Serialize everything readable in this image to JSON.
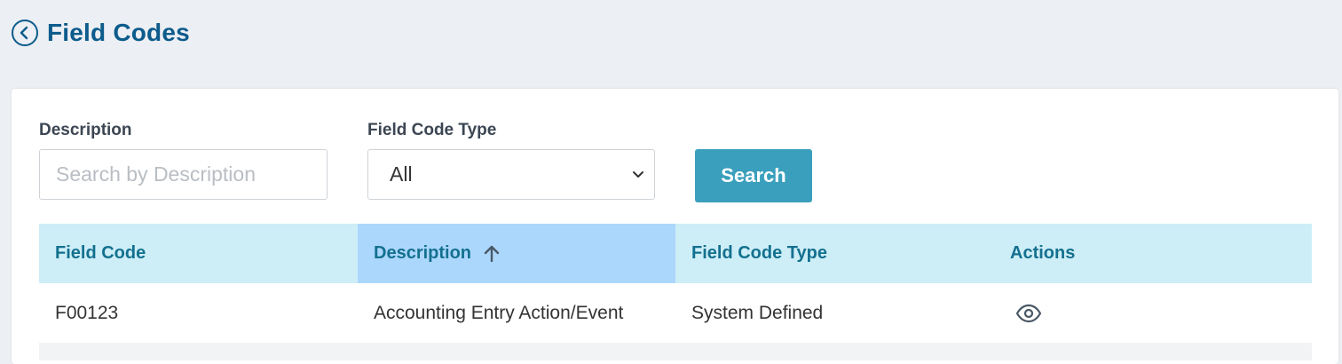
{
  "header": {
    "title": "Field Codes",
    "back_icon": "chevron-left-circle-icon"
  },
  "filters": {
    "description_label": "Description",
    "description_placeholder": "Search by Description",
    "description_value": "",
    "type_label": "Field Code Type",
    "type_selected": "All",
    "search_label": "Search"
  },
  "table": {
    "columns": [
      {
        "label": "Field Code"
      },
      {
        "label": "Description",
        "sorted": "ascending",
        "sort_icon": "arrow-up-icon"
      },
      {
        "label": "Field Code Type"
      },
      {
        "label": "Actions"
      }
    ],
    "rows": [
      {
        "field_code": "F00123",
        "description": "Accounting Entry Action/Event",
        "type": "System Defined",
        "action_icon": "eye-icon"
      }
    ]
  },
  "colors": {
    "title": "#0c5c8c",
    "header_bg": "#cdeef7",
    "sorted_header_bg": "#acd7fc",
    "header_text": "#13708f",
    "button_bg": "#3a9fbd",
    "page_bg": "#eceff3"
  }
}
